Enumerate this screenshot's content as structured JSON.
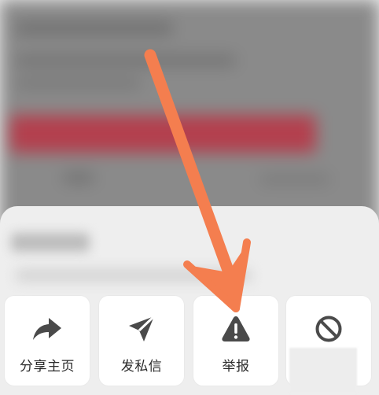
{
  "actions": [
    {
      "label": "分享主页",
      "icon": "share-icon"
    },
    {
      "label": "发私信",
      "icon": "send-message-icon"
    },
    {
      "label": "举报",
      "icon": "warning-icon"
    },
    {
      "label": "",
      "icon": "block-icon"
    }
  ],
  "colors": {
    "sheet": "#eeeeee",
    "card": "#ffffff",
    "icon": "#4a4a4a",
    "arrow": "#f47e4f",
    "background_accent": "#b3404e"
  }
}
